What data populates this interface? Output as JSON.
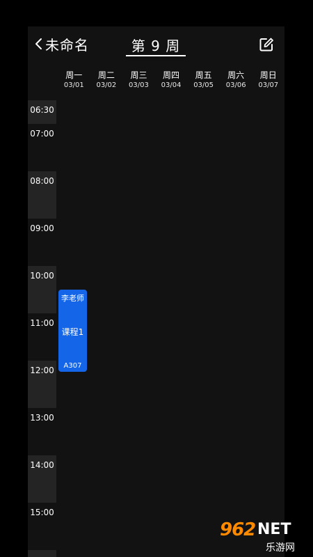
{
  "header": {
    "back_label": "未命名",
    "week_title": "第 9 周"
  },
  "days": [
    {
      "name": "周一",
      "date": "03/01"
    },
    {
      "name": "周二",
      "date": "03/02"
    },
    {
      "name": "周三",
      "date": "03/03"
    },
    {
      "name": "周四",
      "date": "03/04"
    },
    {
      "name": "周五",
      "date": "03/05"
    },
    {
      "name": "周六",
      "date": "03/06"
    },
    {
      "name": "周日",
      "date": "03/07"
    }
  ],
  "time_slots": [
    "06:30",
    "07:00",
    "08:00",
    "09:00",
    "10:00",
    "11:00",
    "12:00",
    "13:00",
    "14:00",
    "15:00"
  ],
  "course": {
    "teacher": "李老师",
    "name": "课程1",
    "room": "A307",
    "color": "#1565e8"
  },
  "watermark": {
    "number": "962",
    "suffix": "NET",
    "sub": "乐游网"
  }
}
